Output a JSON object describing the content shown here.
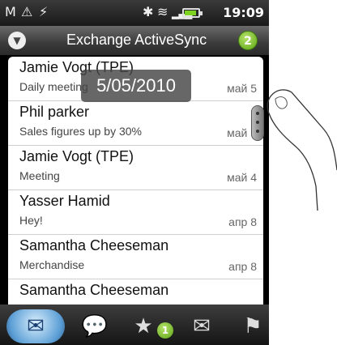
{
  "status": {
    "time": "19:09",
    "icons": [
      "gmail-icon",
      "warning-icon",
      "usb-icon",
      "bluetooth-icon",
      "wifi-icon",
      "signal-icon",
      "battery-icon"
    ]
  },
  "header": {
    "title": "Exchange ActiveSync",
    "unread_count": "2"
  },
  "date_popup": "5/05/2010",
  "messages": [
    {
      "name": "Jamie Vogt (TPE)",
      "subject": "Daily meeting",
      "date": "май 5"
    },
    {
      "name": "Phil parker",
      "subject": "Sales figures up by 30%",
      "date": "май 5"
    },
    {
      "name": "Jamie Vogt (TPE)",
      "subject": "Meeting",
      "date": "май 4"
    },
    {
      "name": "Yasser Hamid",
      "subject": "Hey!",
      "date": "апр 8"
    },
    {
      "name": "Samantha Cheeseman",
      "subject": "Merchandise",
      "date": "апр 8"
    },
    {
      "name": "Samantha Cheeseman",
      "subject": "",
      "date": ""
    }
  ],
  "tabs": [
    {
      "name": "inbox",
      "icon": "inbox-icon"
    },
    {
      "name": "conversations",
      "icon": "chat-icon"
    },
    {
      "name": "favorites",
      "icon": "star-envelope-icon",
      "badge": "1"
    },
    {
      "name": "unread",
      "icon": "envelope-icon"
    },
    {
      "name": "flagged",
      "icon": "flag-icon"
    }
  ]
}
